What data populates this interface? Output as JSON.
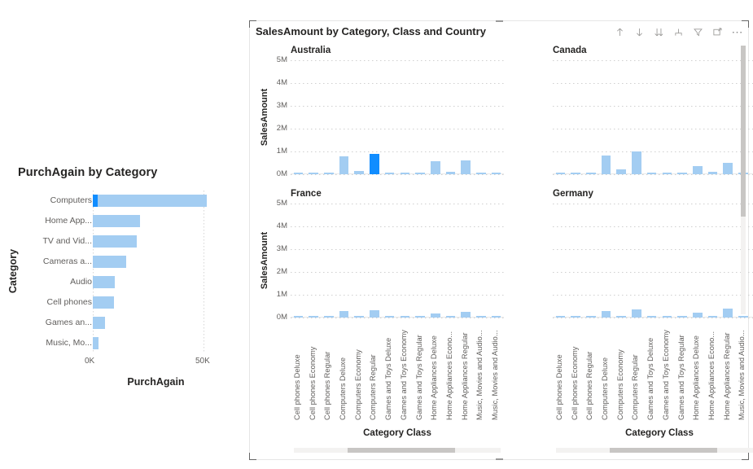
{
  "left_visual": {
    "title": "PurchAgain by Category",
    "y_axis_title": "Category",
    "x_axis_title": "PurchAgain",
    "x_ticks": [
      "0K",
      "50K"
    ]
  },
  "right_visual": {
    "title": "SalesAmount by Category, Class and Country",
    "y_axis_title": "SalesAmount",
    "x_axis_title": "Category Class",
    "y_ticks": [
      "5M",
      "4M",
      "3M",
      "2M",
      "1M",
      "0M"
    ],
    "panel_titles": [
      "Australia",
      "Canada",
      "France",
      "Germany"
    ],
    "toolbar": [
      {
        "name": "drill-up-icon",
        "label": "Drill up"
      },
      {
        "name": "drill-down-icon",
        "label": "Drill down"
      },
      {
        "name": "expand-all-icon",
        "label": "Expand all down one level in the hierarchy"
      },
      {
        "name": "drill-mode-icon",
        "label": "Go to the next level in the hierarchy"
      },
      {
        "name": "filter-icon",
        "label": "Filters"
      },
      {
        "name": "focus-mode-icon",
        "label": "Focus mode"
      },
      {
        "name": "more-options-icon",
        "label": "More options"
      }
    ]
  },
  "chart_data": [
    {
      "type": "bar",
      "orientation": "horizontal",
      "title": "PurchAgain by Category",
      "xlabel": "PurchAgain",
      "ylabel": "Category",
      "xlim": [
        0,
        57000
      ],
      "grid": true,
      "x_tick_values": [
        0,
        50000
      ],
      "x_tick_labels": [
        "0K",
        "50K"
      ],
      "categories": [
        "Computers",
        "Home App...",
        "TV and Vid...",
        "Cameras a...",
        "Audio",
        "Cell phones",
        "Games an...",
        "Music, Mo..."
      ],
      "values": [
        51500,
        21500,
        20000,
        15000,
        10000,
        9500,
        5500,
        2500
      ],
      "highlight": {
        "category": "Computers",
        "value": 2200,
        "color": "#118DFF"
      },
      "bar_color": "#a3cdf2"
    },
    {
      "type": "bar",
      "title": "SalesAmount by Category, Class and Country",
      "subplot_layout": "2x2 small multiples",
      "xlabel": "Category Class",
      "ylabel": "SalesAmount",
      "ylim": [
        0,
        5000000
      ],
      "y_tick_values": [
        0,
        1000000,
        2000000,
        3000000,
        4000000,
        5000000
      ],
      "y_tick_labels": [
        "0M",
        "1M",
        "2M",
        "3M",
        "4M",
        "5M"
      ],
      "grid": true,
      "bar_color": "#a3cdf2",
      "highlight_color": "#118DFF",
      "categories": [
        "Cell phones Deluxe",
        "Cell phones Economy",
        "Cell phones Regular",
        "Computers Deluxe",
        "Computers Economy",
        "Computers Regular",
        "Games and Toys Deluxe",
        "Games and Toys Economy",
        "Games and Toys Regular",
        "Home Appliances Deluxe",
        "Home Appliances Econo...",
        "Home Appliances Regular",
        "Music, Movies and Audio...",
        "Music, Movies and Audio..."
      ],
      "panels": [
        {
          "name": "Australia",
          "values": [
            40000,
            20000,
            70000,
            800000,
            150000,
            900000,
            20000,
            15000,
            15000,
            570000,
            90000,
            620000,
            25000,
            20000
          ],
          "highlight_index": 5
        },
        {
          "name": "Canada",
          "values": [
            50000,
            25000,
            80000,
            820000,
            200000,
            1000000,
            25000,
            18000,
            18000,
            350000,
            110000,
            500000,
            30000,
            25000
          ],
          "highlight_index": null
        },
        {
          "name": "France",
          "values": [
            25000,
            15000,
            40000,
            280000,
            60000,
            320000,
            12000,
            10000,
            10000,
            190000,
            45000,
            260000,
            15000,
            12000
          ],
          "highlight_index": null
        },
        {
          "name": "Germany",
          "values": [
            28000,
            16000,
            45000,
            300000,
            65000,
            340000,
            13000,
            11000,
            11000,
            200000,
            50000,
            380000,
            16000,
            13000
          ],
          "highlight_index": null
        }
      ]
    }
  ]
}
